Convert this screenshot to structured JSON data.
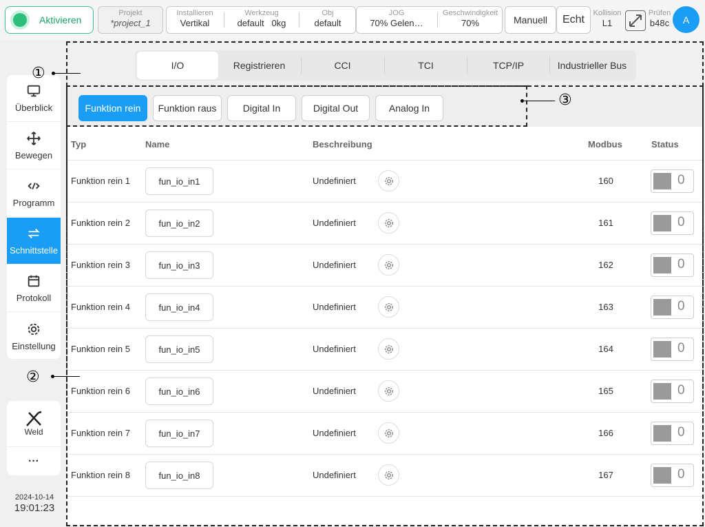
{
  "topbar": {
    "activate_label": "Aktivieren",
    "project": {
      "title": "Projekt",
      "value": "*project_1"
    },
    "install": {
      "title": "Installieren",
      "value": "Vertikal"
    },
    "tool": {
      "title": "Werkzeug",
      "value": "default",
      "mass": "0kg"
    },
    "obj": {
      "title": "Obj",
      "value": "default"
    },
    "jog": {
      "title": "JOG",
      "value": "70%  Gelen…"
    },
    "speed": {
      "title": "Geschwindigkeit",
      "value": "70%"
    },
    "mode_label": "Manuell",
    "real_label": "Echt",
    "collision": {
      "title": "Kollision",
      "value": "L1"
    },
    "check": {
      "title": "Prüfen",
      "value": "b48c"
    },
    "avatar_letter": "A"
  },
  "sidebar": {
    "items": [
      {
        "label": "Überblick",
        "icon": "monitor-icon"
      },
      {
        "label": "Bewegen",
        "icon": "move-icon"
      },
      {
        "label": "Programm",
        "icon": "code-icon"
      },
      {
        "label": "Schnittstelle",
        "icon": "interface-icon",
        "active": true
      },
      {
        "label": "Protokoll",
        "icon": "calendar-icon"
      },
      {
        "label": "Einstellung",
        "icon": "gear-icon"
      }
    ],
    "weld_label": "Weld",
    "more_label": "···",
    "date": "2024-10-14",
    "time": "19:01:23"
  },
  "tabs": [
    "I/O",
    "Registrieren",
    "CCI",
    "TCI",
    "TCP/IP",
    "Industrieller Bus"
  ],
  "subtabs": [
    "Funktion rein",
    "Funktion raus",
    "Digital In",
    "Digital Out",
    "Analog In"
  ],
  "table": {
    "headers": {
      "typ": "Typ",
      "name": "Name",
      "desc": "Beschreibung",
      "modbus": "Modbus",
      "status": "Status"
    },
    "rows": [
      {
        "typ": "Funktion rein 1",
        "name": "fun_io_in1",
        "desc": "Undefiniert",
        "modbus": "160",
        "status": "0"
      },
      {
        "typ": "Funktion rein 2",
        "name": "fun_io_in2",
        "desc": "Undefiniert",
        "modbus": "161",
        "status": "0"
      },
      {
        "typ": "Funktion rein 3",
        "name": "fun_io_in3",
        "desc": "Undefiniert",
        "modbus": "162",
        "status": "0"
      },
      {
        "typ": "Funktion rein 4",
        "name": "fun_io_in4",
        "desc": "Undefiniert",
        "modbus": "163",
        "status": "0"
      },
      {
        "typ": "Funktion rein 5",
        "name": "fun_io_in5",
        "desc": "Undefiniert",
        "modbus": "164",
        "status": "0"
      },
      {
        "typ": "Funktion rein 6",
        "name": "fun_io_in6",
        "desc": "Undefiniert",
        "modbus": "165",
        "status": "0"
      },
      {
        "typ": "Funktion rein 7",
        "name": "fun_io_in7",
        "desc": "Undefiniert",
        "modbus": "166",
        "status": "0"
      },
      {
        "typ": "Funktion rein 8",
        "name": "fun_io_in8",
        "desc": "Undefiniert",
        "modbus": "167",
        "status": "0"
      }
    ]
  },
  "callouts": [
    "①",
    "②",
    "③"
  ],
  "colors": {
    "accent": "#1a9df5",
    "activate_green": "#2fbf7d"
  }
}
